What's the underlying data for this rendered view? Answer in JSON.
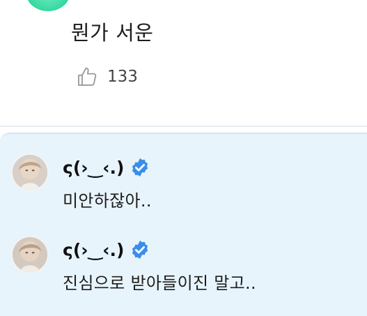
{
  "post": {
    "text": "뭔가 서운",
    "likes": "133",
    "avatar_color": "#35d8a0"
  },
  "replies": [
    {
      "author": "ς(›‿‹.)",
      "verified": true,
      "text": "미안하잖아.."
    },
    {
      "author": "ς(›‿‹.)",
      "verified": true,
      "text": "진심으로 받아들이진 말고.."
    }
  ],
  "colors": {
    "reply_background": "#e8f4fc",
    "verified_badge": "#3b8ee8"
  },
  "icons": {
    "like": "thumbs-up-icon",
    "verified": "verified-badge-icon"
  }
}
